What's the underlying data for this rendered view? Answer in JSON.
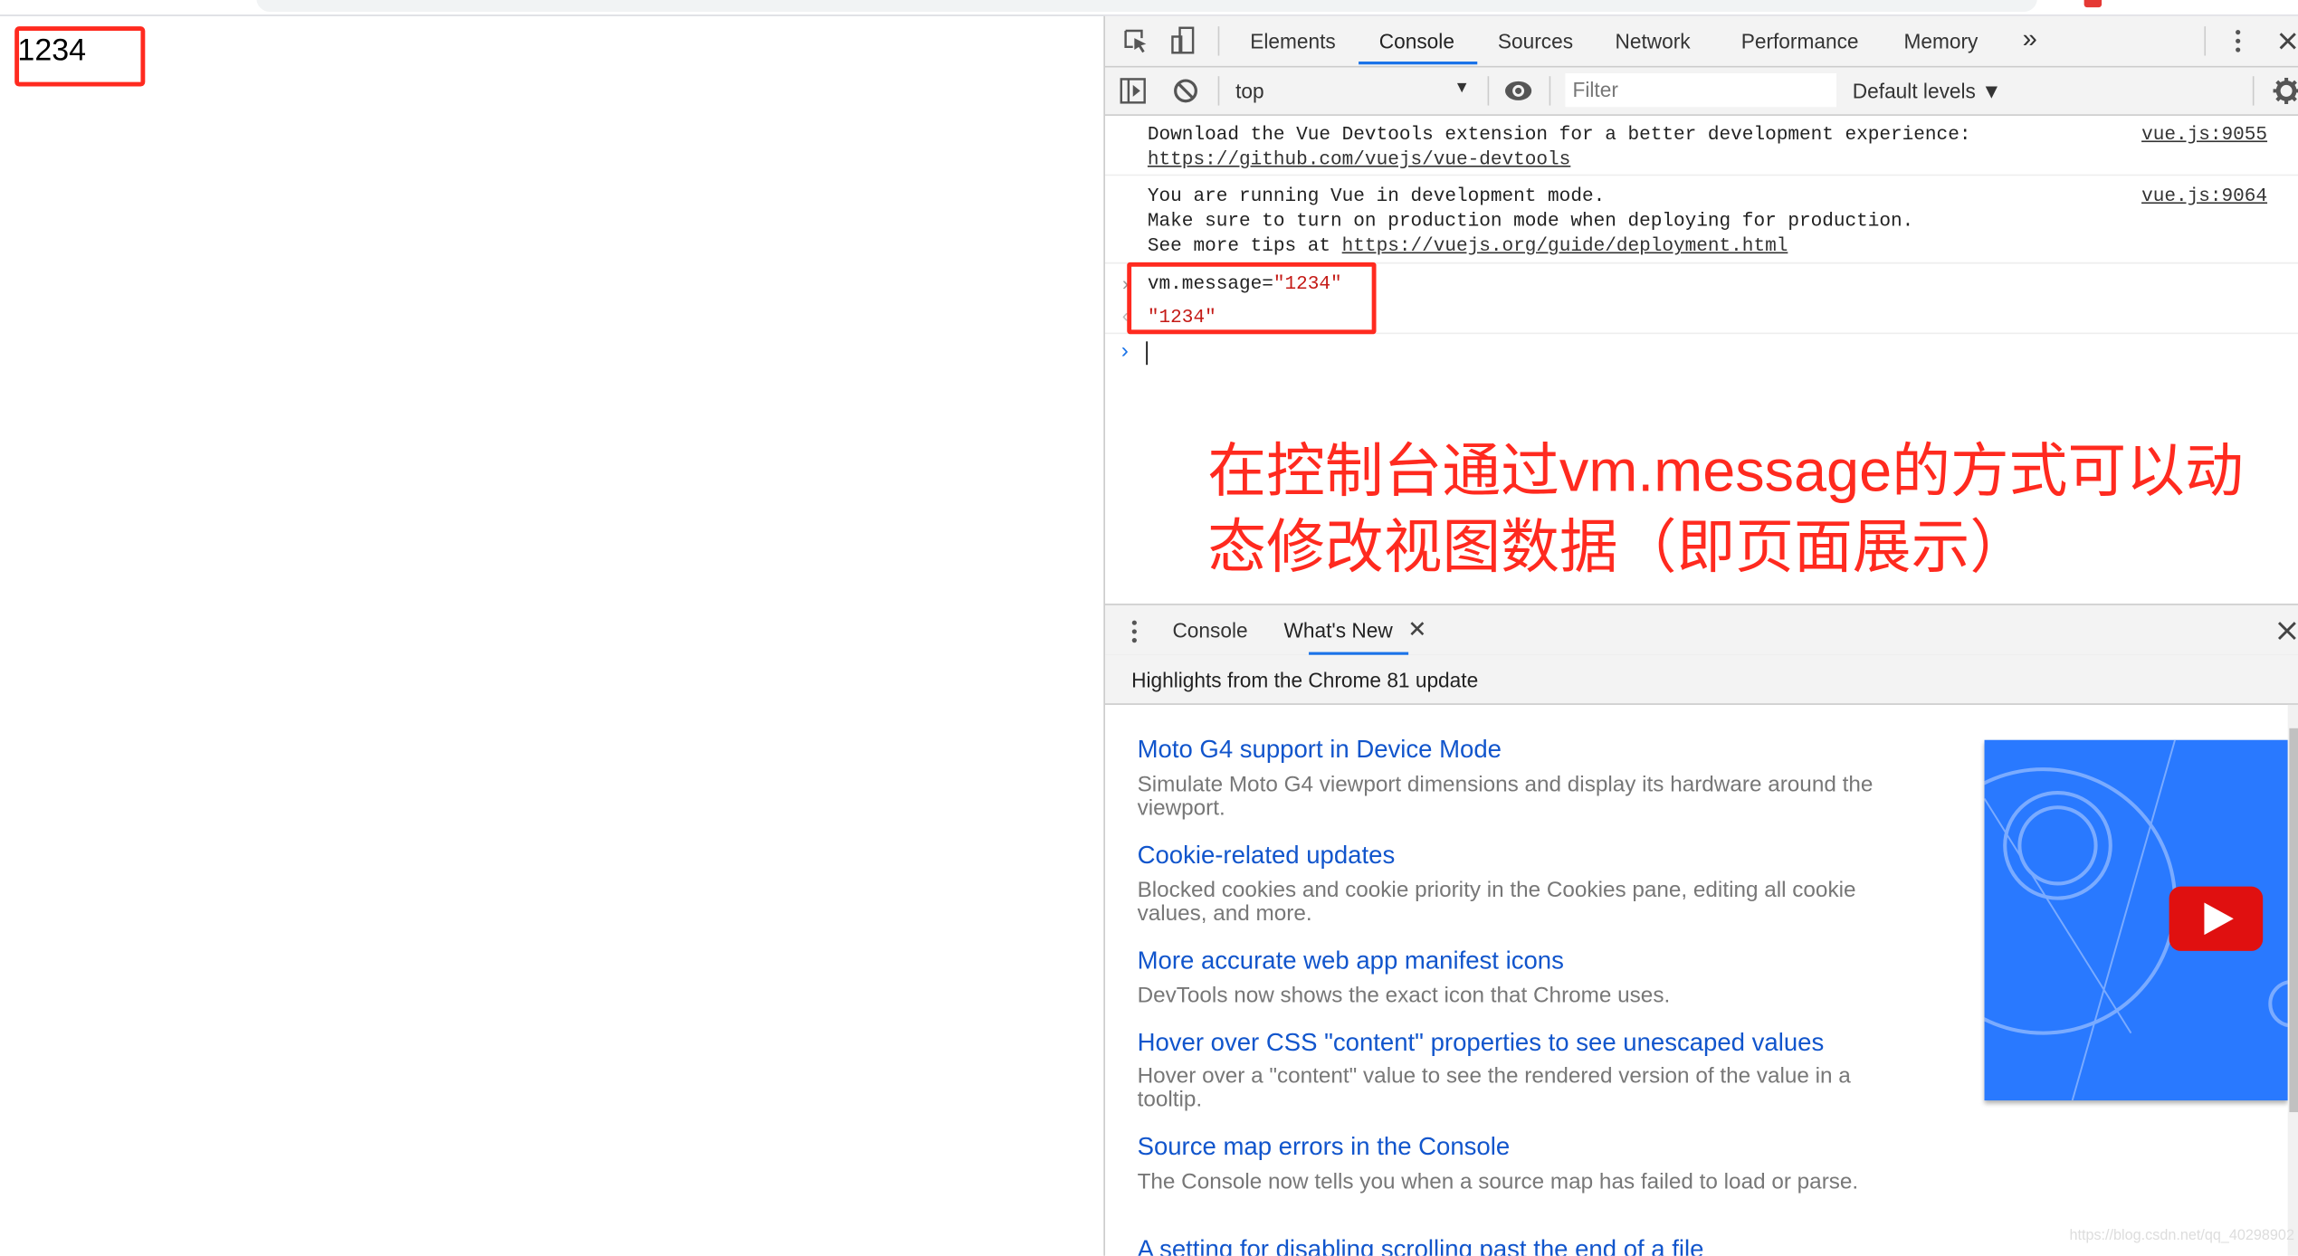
{
  "page": {
    "value": "1234"
  },
  "devtools": {
    "tabs": [
      {
        "label": "Elements"
      },
      {
        "label": "Console",
        "active": true
      },
      {
        "label": "Sources"
      },
      {
        "label": "Network"
      },
      {
        "label": "Performance"
      },
      {
        "label": "Memory"
      }
    ],
    "more_tabs": "»",
    "toolbar": {
      "context": "top",
      "filter_placeholder": "Filter",
      "levels": "Default levels ▼"
    },
    "messages": [
      {
        "lines": [
          "Download the Vue Devtools extension for a better development experience:"
        ],
        "link": "https://github.com/vuejs/vue-devtools",
        "source": "vue.js:9055"
      },
      {
        "lines": [
          "You are running Vue in development mode.",
          "Make sure to turn on production mode when deploying for production."
        ],
        "prefix": "See more tips at ",
        "link": "https://vuejs.org/guide/deployment.html",
        "source": "vue.js:9064"
      }
    ],
    "command": {
      "input_code": "vm.message=",
      "input_value": "\"1234\"",
      "result": "\"1234\""
    },
    "annotation": "在控制台通过vm.message的方式可以动态修改视图数据（即页面展示）",
    "drawer": {
      "tabs": [
        {
          "label": "Console"
        },
        {
          "label": "What's New",
          "active": true
        }
      ],
      "header": "Highlights from the Chrome 81 update",
      "items": [
        {
          "title": "Moto G4 support in Device Mode",
          "desc": "Simulate Moto G4 viewport dimensions and display its hardware around the viewport."
        },
        {
          "title": "Cookie-related updates",
          "desc": "Blocked cookies and cookie priority in the Cookies pane, editing all cookie values, and more."
        },
        {
          "title": "More accurate web app manifest icons",
          "desc": "DevTools now shows the exact icon that Chrome uses."
        },
        {
          "title": "Hover over CSS \"content\" properties to see unescaped values",
          "desc": "Hover over a \"content\" value to see the rendered version of the value in a tooltip."
        },
        {
          "title": "Source map errors in the Console",
          "desc": "The Console now tells you when a source map has failed to load or parse."
        },
        {
          "title": "A setting for disabling scrolling past the end of a file",
          "desc": ""
        }
      ]
    }
  },
  "watermark": "https://blog.csdn.net/qq_40298902",
  "colors": {
    "accent": "#1a73e8",
    "annotation": "#ff2a1f",
    "link": "#1155cc",
    "thumb": "#2979ff"
  }
}
